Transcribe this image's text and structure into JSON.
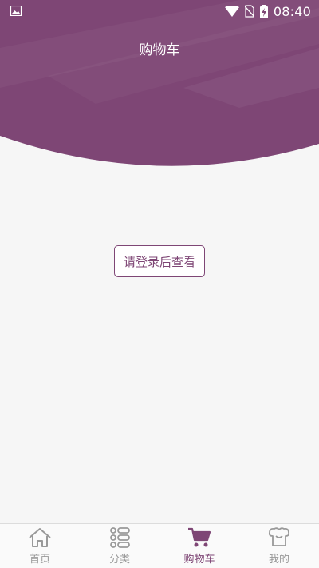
{
  "status_bar": {
    "time": "08:40",
    "left_icon": "image-notification-icon",
    "right_icons": [
      "wifi-icon",
      "no-sim-icon",
      "battery-charging-icon"
    ]
  },
  "header": {
    "title": "购物车",
    "background_color": "#7e4675"
  },
  "main": {
    "login_button_label": "请登录后查看"
  },
  "tabbar": {
    "tabs": [
      {
        "label": "首页",
        "icon": "home-icon",
        "active": false
      },
      {
        "label": "分类",
        "icon": "category-list-icon",
        "active": false
      },
      {
        "label": "购物车",
        "icon": "cart-icon",
        "active": true
      },
      {
        "label": "我的",
        "icon": "profile-icon",
        "active": false
      }
    ],
    "active_color": "#7e4675",
    "inactive_color": "#999999"
  }
}
